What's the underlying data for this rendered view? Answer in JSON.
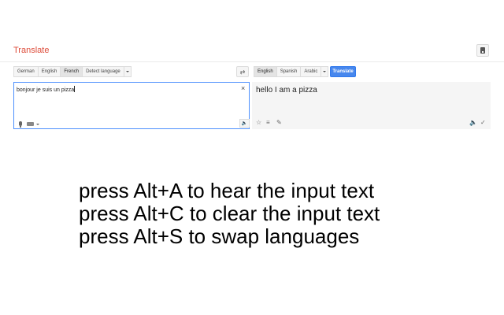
{
  "header": {
    "title": "Translate",
    "options_icon": "page-icon"
  },
  "source": {
    "languages": [
      {
        "label": "German",
        "active": false
      },
      {
        "label": "English",
        "active": false
      },
      {
        "label": "French",
        "active": true
      },
      {
        "label": "Detect language",
        "active": false
      }
    ],
    "text": "bonjour je suis un pizza",
    "clear_icon": "×",
    "listen_icon": "speaker-icon"
  },
  "swap_icon": "swap-icon",
  "target": {
    "languages": [
      {
        "label": "English",
        "active": true
      },
      {
        "label": "Spanish",
        "active": false
      },
      {
        "label": "Arabic",
        "active": false
      }
    ],
    "translate_label": "Translate",
    "text": "hello I am a pizza",
    "icons": [
      "star-icon",
      "list-icon",
      "pencil-icon",
      "speaker-icon",
      "check-icon"
    ]
  },
  "instructions": [
    "press Alt+A to hear the input text",
    "press Alt+C to clear the input text",
    "press Alt+S to swap languages"
  ]
}
